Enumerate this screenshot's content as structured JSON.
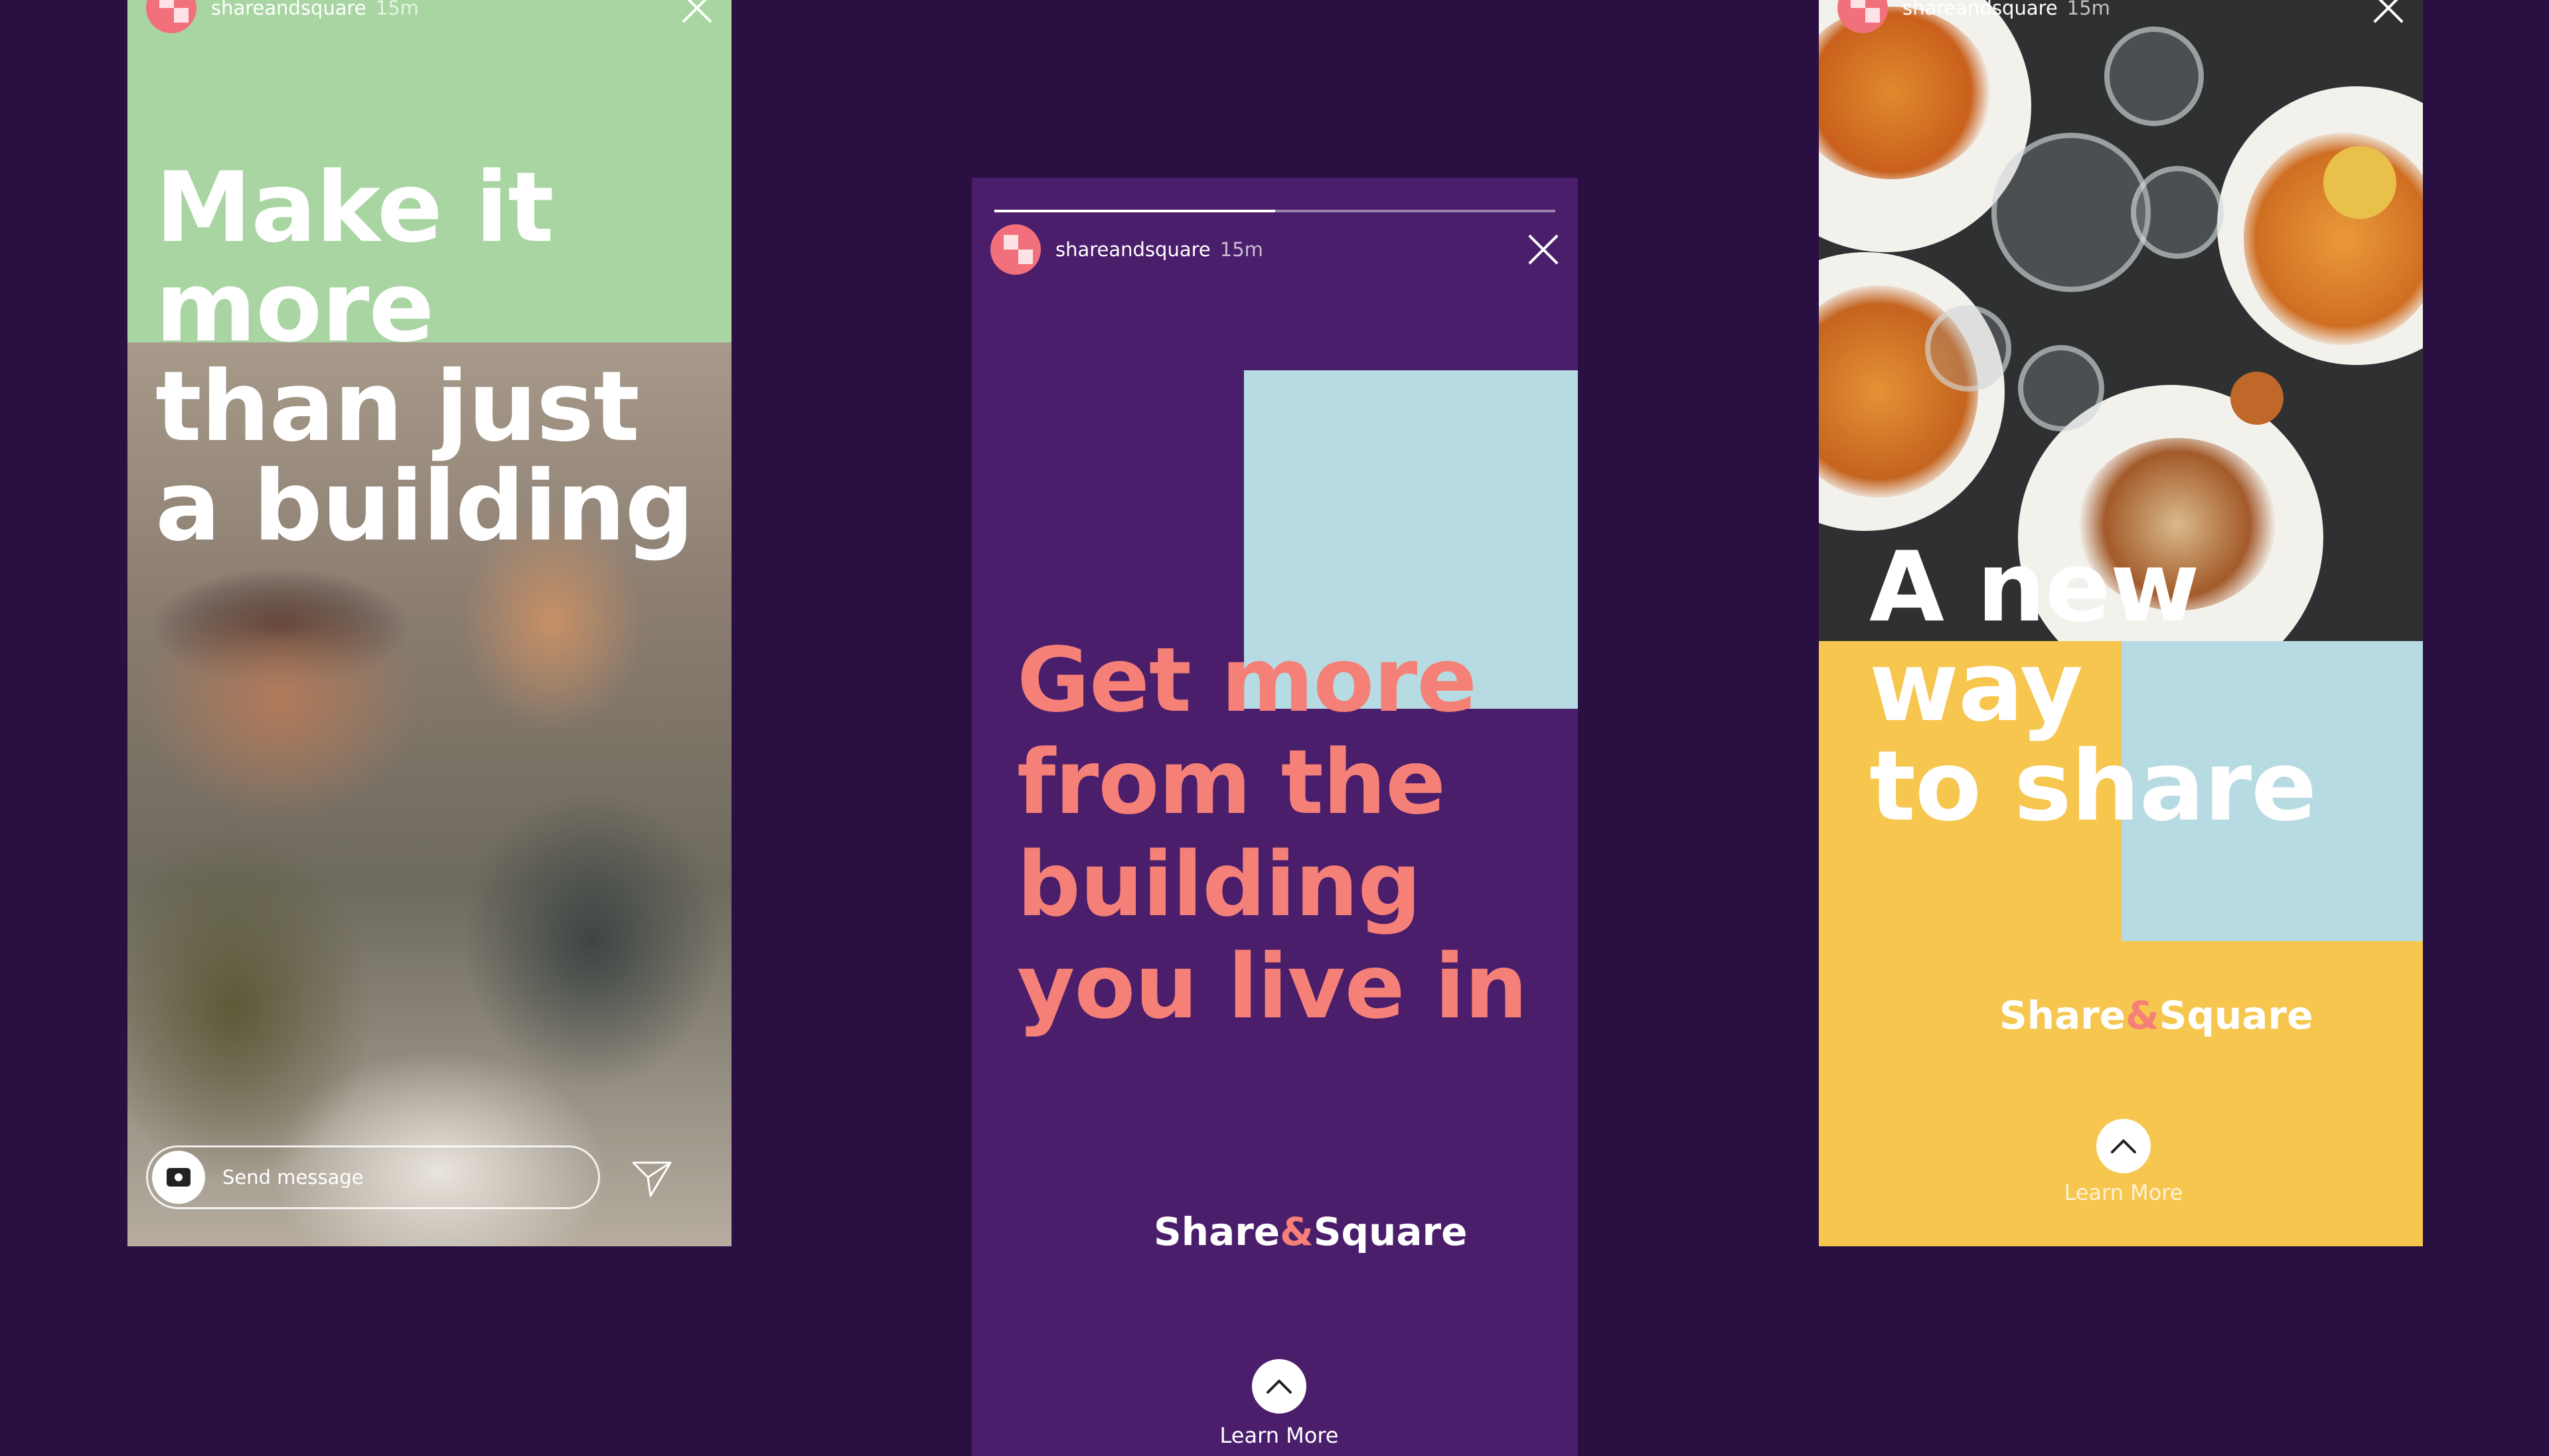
{
  "stories": [
    {
      "username": "shareandsquare",
      "time": "15m",
      "headline_lines": [
        "Make it",
        "more",
        "than just",
        "a building"
      ],
      "message_placeholder": "Send message",
      "colors": {
        "top": "#a8d5a2",
        "text": "#ffffff"
      }
    },
    {
      "username": "shareandsquare",
      "time": "15m",
      "progress": 0.5,
      "headline_lines": [
        "Get more",
        "from the",
        "building",
        "you live in"
      ],
      "logo": {
        "part1": "Share",
        "amp": "&",
        "part2": "Square"
      },
      "cta": "Learn More",
      "colors": {
        "background": "#4a1e6b",
        "headline": "#f58077",
        "accent_block": "#b7dbe2"
      }
    },
    {
      "username": "shareandsquare",
      "time": "15m",
      "headline_lines": [
        "A new",
        "way",
        "to share"
      ],
      "logo": {
        "part1": "Share",
        "amp": "&",
        "part2": "Square"
      },
      "cta": "Learn More",
      "colors": {
        "background": "#f6c64e",
        "accent_block": "#b7dbe2"
      }
    }
  ],
  "page": {
    "background": "#2a1042"
  }
}
